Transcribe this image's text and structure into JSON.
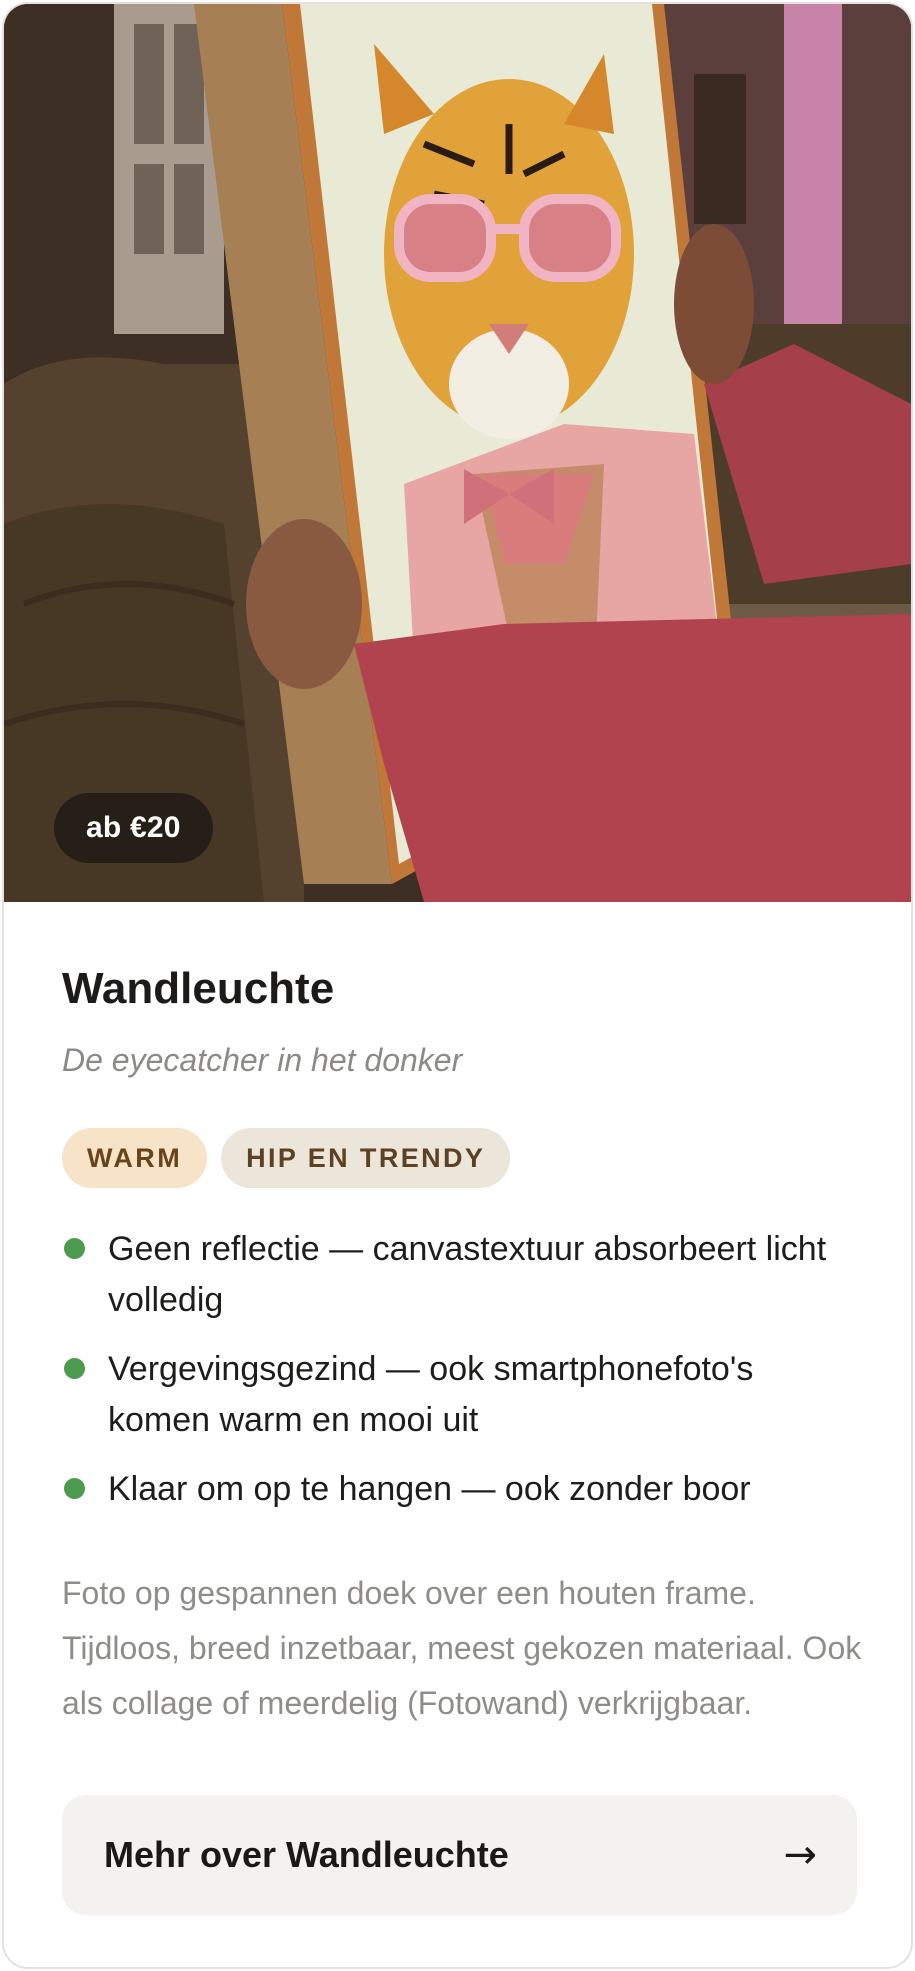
{
  "hero": {
    "image": "tiger-portrait-lightbox-photo",
    "price_badge": "ab €20"
  },
  "product": {
    "title": "Wandleuchte",
    "subtitle": "De eyecatcher in het donker",
    "tags": [
      "WARM",
      "HIP EN TRENDY"
    ],
    "features": [
      "Geen reflectie — canvastextuur absorbeert licht volledig",
      "Vergevingsgezind — ook smartphonefoto's komen warm en mooi uit",
      "Klaar om op te hangen — ook zonder boor"
    ],
    "description": "Foto op gespannen doek over een houten frame. Tijdloos, breed inzetbaar, meest gekozen materiaal. Ook als collage of meerdelig (Fotowand) verkrijgbaar."
  },
  "cta": {
    "label": "Mehr over Wandleuchte",
    "arrow": "→"
  },
  "colors": {
    "accent_green": "#4c9a4e",
    "tag_warm_bg": "#f6e3c8",
    "tag_hip_bg": "#ebe5da",
    "cta_bg": "#f3f2ee"
  }
}
